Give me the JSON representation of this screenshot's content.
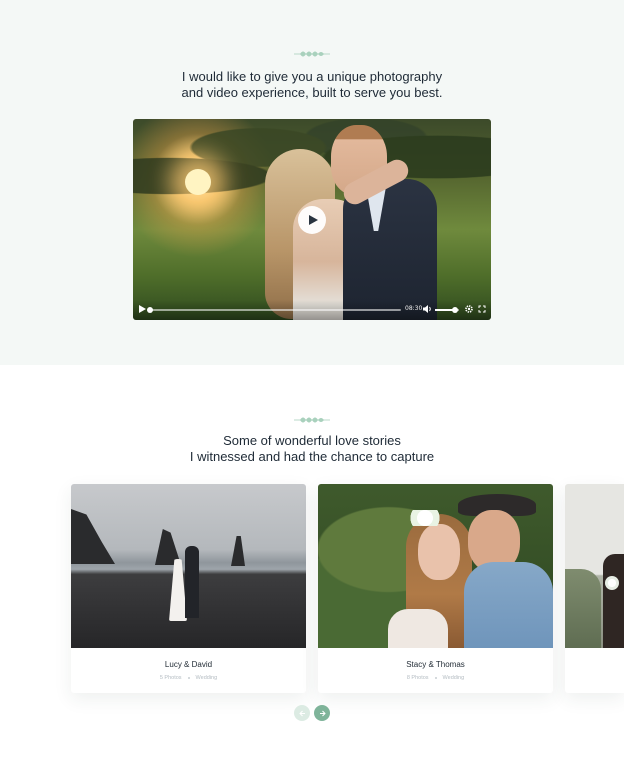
{
  "intro": {
    "ornament_icon": "leaf-branch-icon",
    "line1": "I would like to give you a unique photography",
    "line2": "and video experience, built to serve you best."
  },
  "video_player": {
    "play_icon": "play-icon",
    "time": "08:30",
    "progress": 0.0,
    "volume": 0.85,
    "controls": [
      "play-icon",
      "volume-icon",
      "settings-icon",
      "fullscreen-icon"
    ]
  },
  "stories": {
    "ornament_icon": "leaf-branch-icon",
    "line1": "Some of wonderful love stories",
    "line2": "I witnessed and had the chance to capture",
    "cards": [
      {
        "title": "Lucy & David",
        "photos": "5 Photos",
        "category": "Wedding"
      },
      {
        "title": "Stacy & Thomas",
        "photos": "8 Photos",
        "category": "Wedding"
      }
    ],
    "prev_icon": "arrow-left-icon",
    "next_icon": "arrow-right-icon"
  },
  "colors": {
    "accent": "#7fb49a",
    "accent_light": "#cfe5da",
    "section_bg": "#f4f8f6",
    "text": "#1e2a36",
    "muted": "#b4bcc2"
  }
}
